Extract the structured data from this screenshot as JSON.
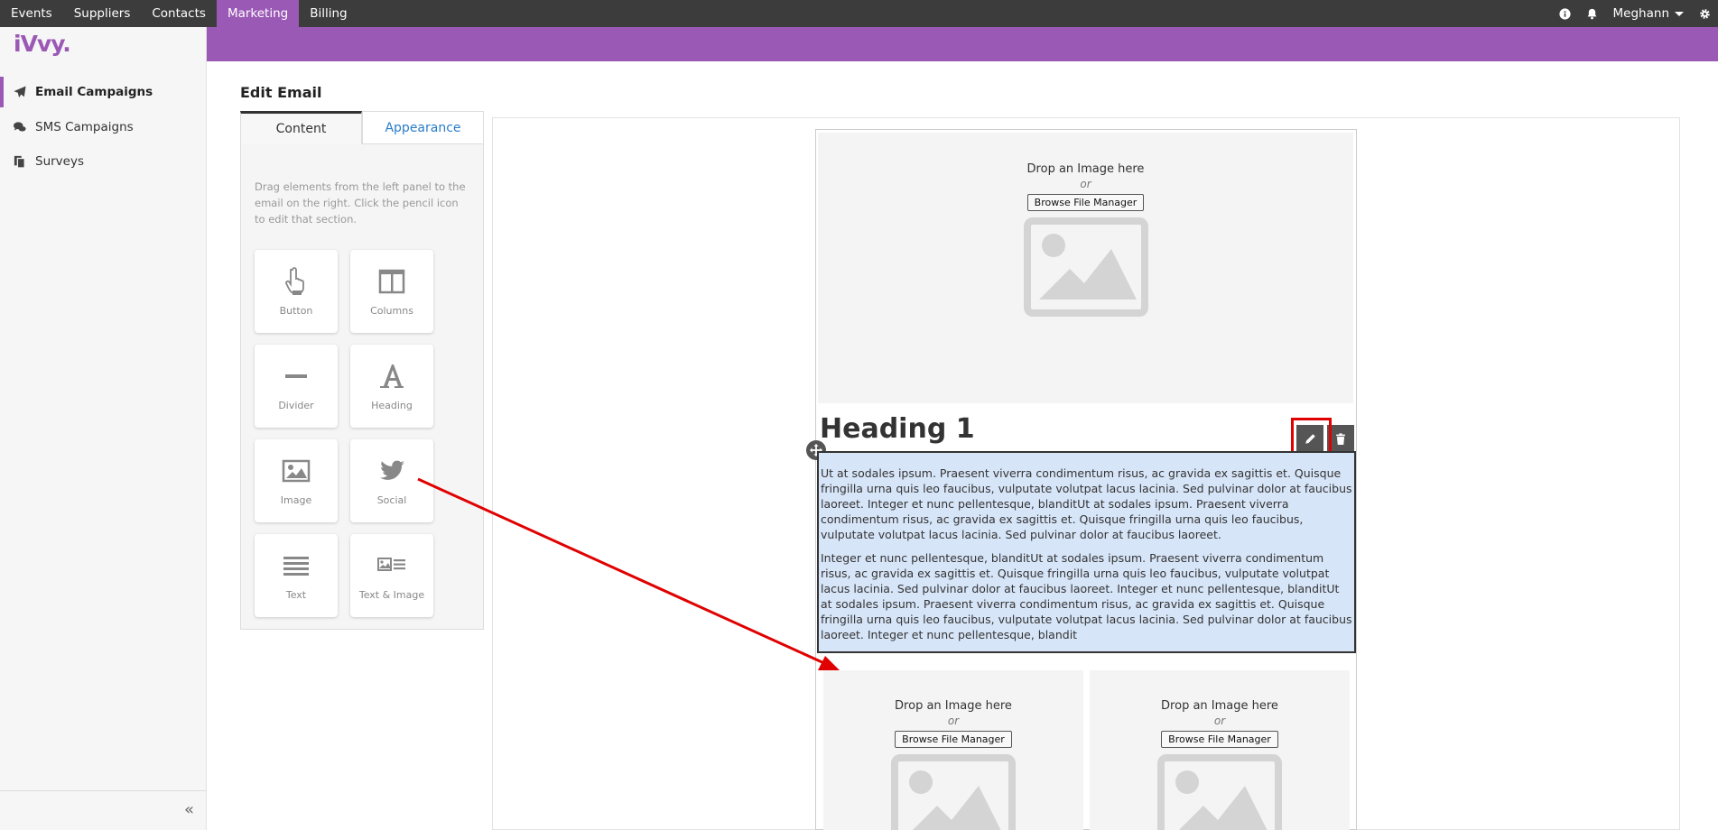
{
  "topnav": {
    "items": [
      "Events",
      "Suppliers",
      "Contacts",
      "Marketing",
      "Billing"
    ],
    "active_index": 3,
    "user_name": "Meghann"
  },
  "sidebar": {
    "logo": "iVvy.",
    "items": [
      {
        "label": "Email Campaigns",
        "icon": "paper-plane-icon",
        "active": true
      },
      {
        "label": "SMS Campaigns",
        "icon": "chat-bubbles-icon",
        "active": false
      },
      {
        "label": "Surveys",
        "icon": "clipboard-icon",
        "active": false
      }
    ],
    "collapse_label": "«"
  },
  "main": {
    "title": "Edit Email",
    "tabs": [
      {
        "label": "Content",
        "active": true
      },
      {
        "label": "Appearance",
        "active": false
      }
    ],
    "help_text": "Drag elements from the left panel to the email on the right. Click the pencil icon to edit that section.",
    "elements": [
      {
        "label": "Button",
        "icon": "hand-pointer-icon"
      },
      {
        "label": "Columns",
        "icon": "columns-icon"
      },
      {
        "label": "Divider",
        "icon": "divider-icon"
      },
      {
        "label": "Heading",
        "icon": "heading-icon"
      },
      {
        "label": "Image",
        "icon": "image-icon"
      },
      {
        "label": "Social",
        "icon": "twitter-icon"
      },
      {
        "label": "Text",
        "icon": "text-lines-icon"
      },
      {
        "label": "Text & Image",
        "icon": "text-image-icon"
      }
    ]
  },
  "email": {
    "drop_title": "Drop an Image here",
    "drop_or": "or",
    "browse_label": "Browse File Manager",
    "heading": "Heading 1",
    "paragraph1": "Ut at sodales ipsum. Praesent viverra condimentum risus, ac gravida ex sagittis et. Quisque fringilla urna quis leo faucibus, vulputate volutpat lacus lacinia. Sed pulvinar dolor at faucibus laoreet. Integer et nunc pellentesque, blanditUt at sodales ipsum. Praesent viverra condimentum risus, ac gravida ex sagittis et. Quisque fringilla urna quis leo faucibus, vulputate volutpat lacus lacinia. Sed pulvinar dolor at faucibus laoreet.",
    "paragraph2": "Integer et nunc pellentesque, blanditUt at sodales ipsum. Praesent viverra condimentum risus, ac gravida ex sagittis et. Quisque fringilla urna quis leo faucibus, vulputate volutpat lacus lacinia. Sed pulvinar dolor at faucibus laoreet. Integer et nunc pellentesque, blanditUt at sodales ipsum. Praesent viverra condimentum risus, ac gravida ex sagittis et. Quisque fringilla urna quis leo faucibus, vulputate volutpat lacus lacinia. Sed pulvinar dolor at faucibus laoreet. Integer et nunc pellentesque, blandit"
  },
  "colors": {
    "accent": "#9b59b6",
    "topbar": "#3c3c3c",
    "annotation": "#e00000",
    "selected_block": "#d7e5f8"
  }
}
